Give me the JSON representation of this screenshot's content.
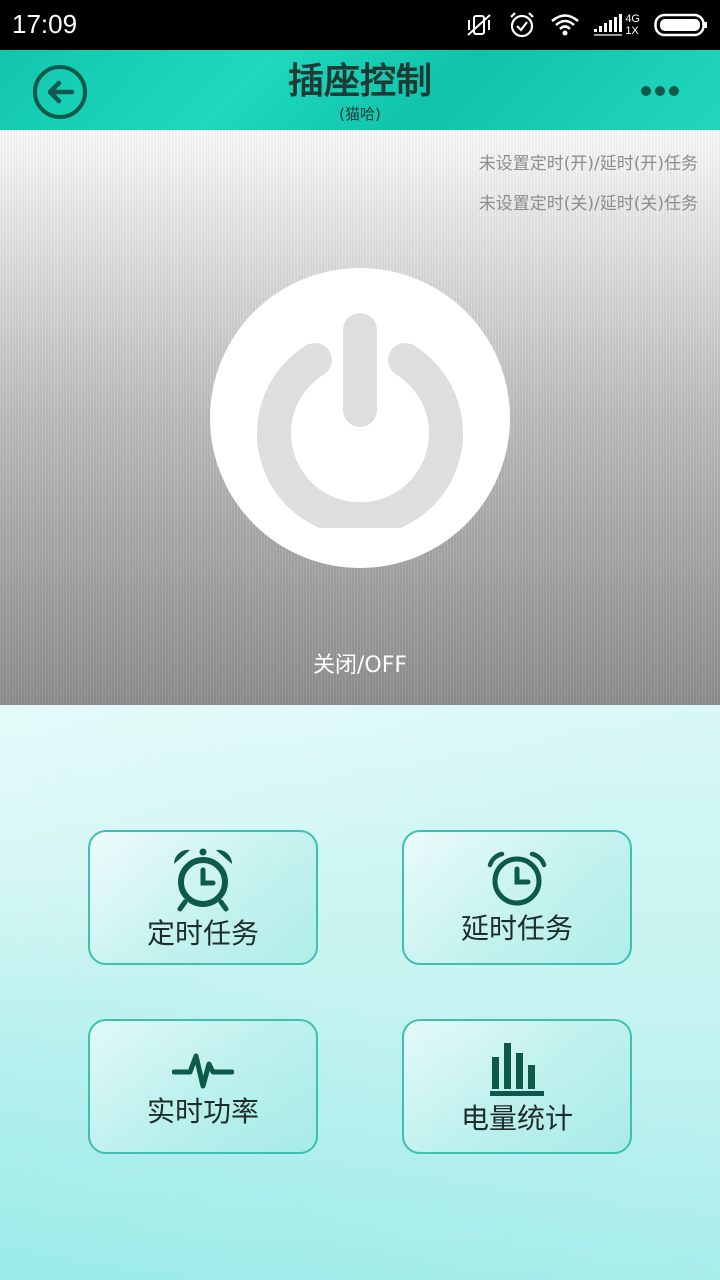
{
  "status_bar": {
    "time": "17:09",
    "icons": [
      "vibrate-off-icon",
      "alarm-icon",
      "wifi-icon",
      "signal-icon",
      "battery-icon"
    ],
    "network_top": "4G",
    "network_bottom": "1X"
  },
  "header": {
    "title": "插座控制",
    "subtitle": "(猫哈)",
    "back_icon": "back-arrow-icon",
    "more_icon": "more-dots-icon",
    "color": "#16c9b0"
  },
  "control": {
    "task_on": "未设置定时(开)/延时(开)任务",
    "task_off": "未设置定时(关)/延时(关)任务",
    "power_icon": "power-icon",
    "state": "关闭/OFF"
  },
  "functions": [
    {
      "label": "定时任务",
      "icon": "alarm-clock-icon"
    },
    {
      "label": "延时任务",
      "icon": "clock-icon"
    },
    {
      "label": "实时功率",
      "icon": "pulse-icon"
    },
    {
      "label": "电量统计",
      "icon": "bar-chart-icon"
    }
  ],
  "colors": {
    "accent": "#16c9b0",
    "icon_dark": "#0e5a4a",
    "tile_border": "#3fbfb0"
  }
}
